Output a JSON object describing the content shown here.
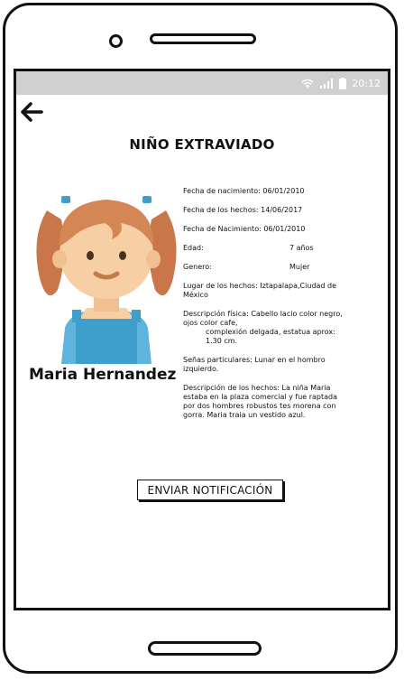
{
  "status_bar": {
    "time": "20:12"
  },
  "page": {
    "title": "NIÑO EXTRAVIADO"
  },
  "person": {
    "name": "Maria Hernandez"
  },
  "details": {
    "fecha_nacimiento_1": "Fecha de nacimiento: 06/01/2010",
    "fecha_hechos": "Fecha de los hechos: 14/06/2017",
    "fecha_nacimiento_2": "Fecha de Nacimiento: 06/01/2010",
    "edad_label": "Edad:",
    "edad_value": "7 años",
    "genero_label": "Genero:",
    "genero_value": "Mujer",
    "lugar": "Lugar de los hechos: Iztapalapa,Ciudad de México",
    "descripcion_fisica_1": "Descripción física: Cabello lacio color negro, ojos color cafe,",
    "descripcion_fisica_2": "complexión delgada, estatua aprox: 1.30 cm.",
    "senas": "Señas particulares: Lunar en el hombro izquierdo.",
    "descripcion_hechos": "Descripción de los hechos: La niña Maria estaba en la plaza comercial y fue raptada por dos hombres robustos tes morena con gorra. Maria traia un vestido azul."
  },
  "actions": {
    "send_label": "ENVIAR NOTIFICACIÓN"
  },
  "icons": {
    "back": "back-arrow-icon",
    "wifi": "wifi-icon",
    "signal": "signal-icon",
    "battery": "battery-icon"
  },
  "colors": {
    "status_bar": "#d0d0d0",
    "hair": "#c9764a",
    "skin": "#f6cfa5",
    "dress": "#3f9fcc"
  }
}
